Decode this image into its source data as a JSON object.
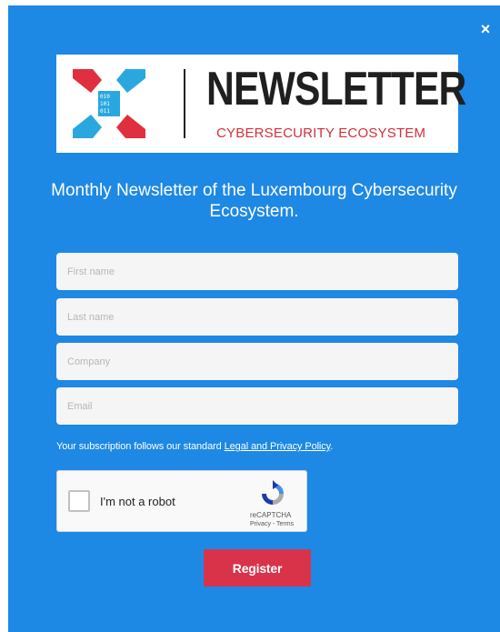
{
  "modal": {
    "close_icon": "close-icon",
    "close_symbol": "×",
    "background_color": "#1e88e5"
  },
  "banner": {
    "title": "NEWSLETTER",
    "subtitle": "CYBERSECURITY ECOSYSTEM",
    "logo_icon": "cybersecurity-x-logo-icon",
    "colors": {
      "red": "#e02f3f",
      "blue": "#2aa7df",
      "title": "#1f1f1f"
    }
  },
  "headline": "Monthly Newsletter of the Luxembourg Cybersecurity Ecosystem.",
  "form": {
    "fields": [
      {
        "name": "first-name",
        "placeholder": "First name",
        "value": ""
      },
      {
        "name": "last-name",
        "placeholder": "Last name",
        "value": ""
      },
      {
        "name": "company",
        "placeholder": "Company",
        "value": ""
      },
      {
        "name": "email",
        "placeholder": "Email",
        "value": ""
      }
    ],
    "notice_prefix": "Your subscription follows our standard ",
    "notice_link": "Legal and Privacy Policy",
    "notice_suffix": "."
  },
  "captcha": {
    "label": "I'm not a robot",
    "brand": "reCAPTCHA",
    "links": "Privacy - Terms",
    "checked": false,
    "icon": "recaptcha-icon"
  },
  "register_button": {
    "label": "Register",
    "color": "#d9334a"
  }
}
